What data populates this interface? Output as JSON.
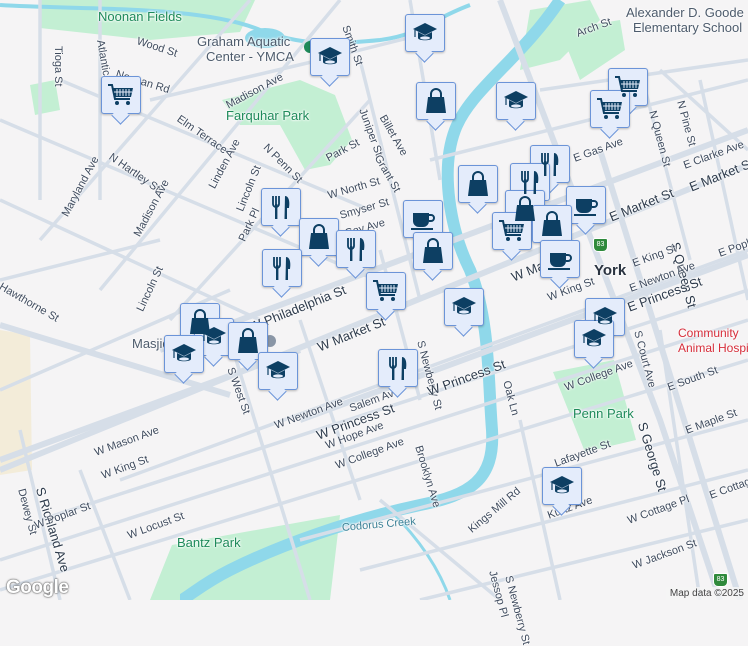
{
  "map": {
    "city_label": "York",
    "parks": [
      "Noonan Fields",
      "Farquhar Park",
      "Penn Park",
      "Bantz Park"
    ],
    "pois": [
      "Graham Aquatic",
      "Center - YMCA",
      "Alexander D. Goode",
      "Elementary School",
      "Community",
      "Animal Hospital",
      "Masjid"
    ],
    "water": [
      "Codorus Creek"
    ],
    "highway_shield": "83",
    "streets": [
      "Wood St",
      "Noonan Rd",
      "Tioga St",
      "Atlantic Ave",
      "Madison Ave",
      "Elm Terrace",
      "N Hartley St",
      "Maryland Ave",
      "Madison Ave",
      "Linden Ave",
      "Lincoln St",
      "N Penn St",
      "Park St",
      "W North St",
      "Smyser St",
      "Gay Ave",
      "Juniper St",
      "Grant St",
      "Billet Ave",
      "Smith St",
      "Arch St",
      "E Gas Ave",
      "N Queen St",
      "N Pine St",
      "E Clarke Ave",
      "E Market St",
      "E Market St",
      "S Queen St",
      "E King St",
      "E Newton Ave",
      "E Poplar St",
      "W King St",
      "E Princess St",
      "W Philadelphia St",
      "W Market St",
      "W Market St",
      "S Newberry St",
      "S West St",
      "W Newton Ave",
      "Salem Ave",
      "W Princess St",
      "W Princess St",
      "W Mason Ave",
      "W King St",
      "S Richland Ave",
      "Dewey St",
      "W Poplar St",
      "W Locust St",
      "W Hope Ave",
      "W College Ave",
      "W College Ave",
      "Brooklyn Ave",
      "Oak Ln",
      "S Court Ave",
      "E South St",
      "E Maple St",
      "S George St",
      "Lafayette St",
      "Kurtz Ave",
      "Kings Mill Rd",
      "W Cottage Pl",
      "E Cottage Pl",
      "W Jackson St",
      "Jessop Pl",
      "S Newberry St",
      "Lincoln St",
      "Hawthorne St",
      "Park Pl",
      "Codorus Creek"
    ],
    "markers": [
      {
        "type": "school"
      },
      {
        "type": "school"
      },
      {
        "type": "grocery"
      },
      {
        "type": "shopping"
      },
      {
        "type": "school"
      },
      {
        "type": "grocery"
      },
      {
        "type": "grocery"
      },
      {
        "type": "restaurant"
      },
      {
        "type": "shopping"
      },
      {
        "type": "restaurant"
      },
      {
        "type": "restaurant"
      },
      {
        "type": "cafe"
      },
      {
        "type": "shopping"
      },
      {
        "type": "shopping"
      },
      {
        "type": "restaurant"
      },
      {
        "type": "restaurant"
      },
      {
        "type": "shopping"
      },
      {
        "type": "grocery"
      },
      {
        "type": "cafe"
      },
      {
        "type": "shopping"
      },
      {
        "type": "cafe"
      },
      {
        "type": "grocery"
      },
      {
        "type": "school"
      },
      {
        "type": "shopping"
      },
      {
        "type": "school"
      },
      {
        "type": "shopping"
      },
      {
        "type": "school"
      },
      {
        "type": "school"
      },
      {
        "type": "restaurant"
      },
      {
        "type": "school"
      },
      {
        "type": "school"
      },
      {
        "type": "school"
      }
    ]
  },
  "footer": {
    "logo": "Google",
    "attribution": "Map data ©2025"
  },
  "colors": {
    "park": "#c3efd3",
    "water": "#8fd8ea",
    "road": "#d6dee8",
    "marker_bg": "#e4ecfb",
    "marker_border": "#6b94d8",
    "icon": "#0d3f63"
  }
}
